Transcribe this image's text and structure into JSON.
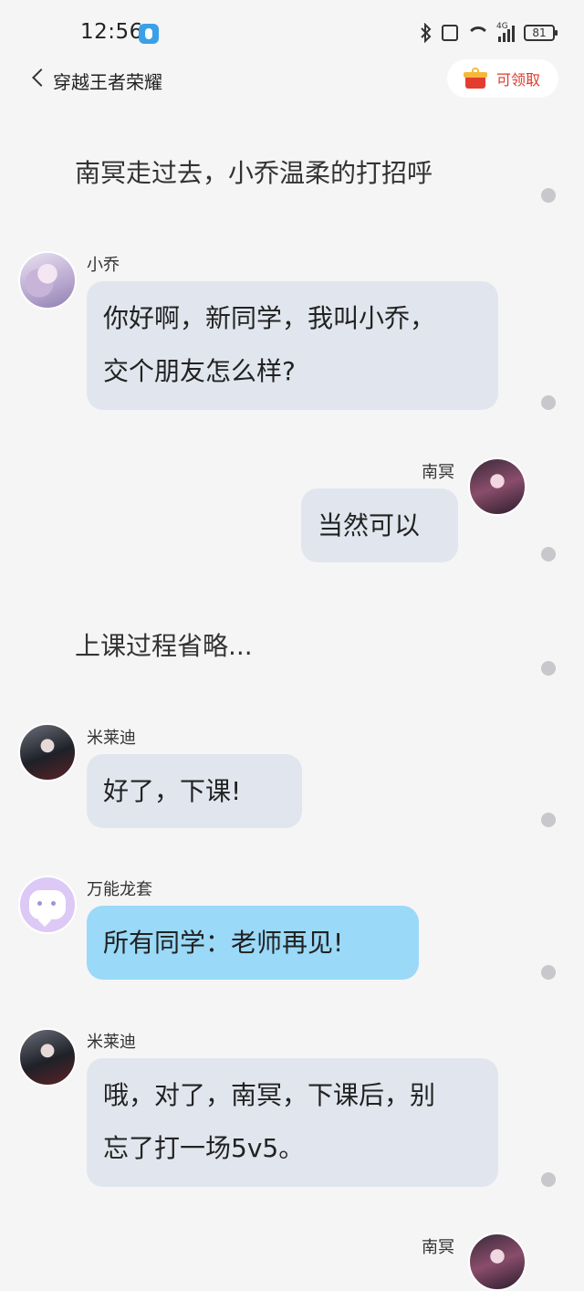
{
  "status_bar": {
    "time": "12:56",
    "network": "4G",
    "battery": "81"
  },
  "header": {
    "title": "穿越王者荣耀",
    "claim_label": "可领取"
  },
  "messages": [
    {
      "type": "narration",
      "text": "南冥走过去，小乔温柔的打招呼"
    },
    {
      "type": "left",
      "sender": "小乔",
      "lines": [
        "你好啊，新同学，我叫小乔，",
        "交个朋友怎么样?"
      ]
    },
    {
      "type": "right",
      "sender": "南冥",
      "lines": [
        "当然可以"
      ]
    },
    {
      "type": "narration",
      "text": "上课过程省略..."
    },
    {
      "type": "left",
      "sender": "米莱迪",
      "lines": [
        "好了，下课!"
      ]
    },
    {
      "type": "left",
      "sender": "万能龙套",
      "lines": [
        "所有同学：老师再见!"
      ]
    },
    {
      "type": "left",
      "sender": "米莱迪",
      "lines": [
        "哦，对了，南冥，下课后，别",
        "忘了打一场5v5。"
      ]
    },
    {
      "type": "right",
      "sender": "南冥",
      "lines": []
    }
  ],
  "colors": {
    "background": "#f5f5f5",
    "bubble_gray": "#e1e6ee",
    "bubble_blue": "#9ad9f7",
    "accent_red": "#e0392b"
  }
}
